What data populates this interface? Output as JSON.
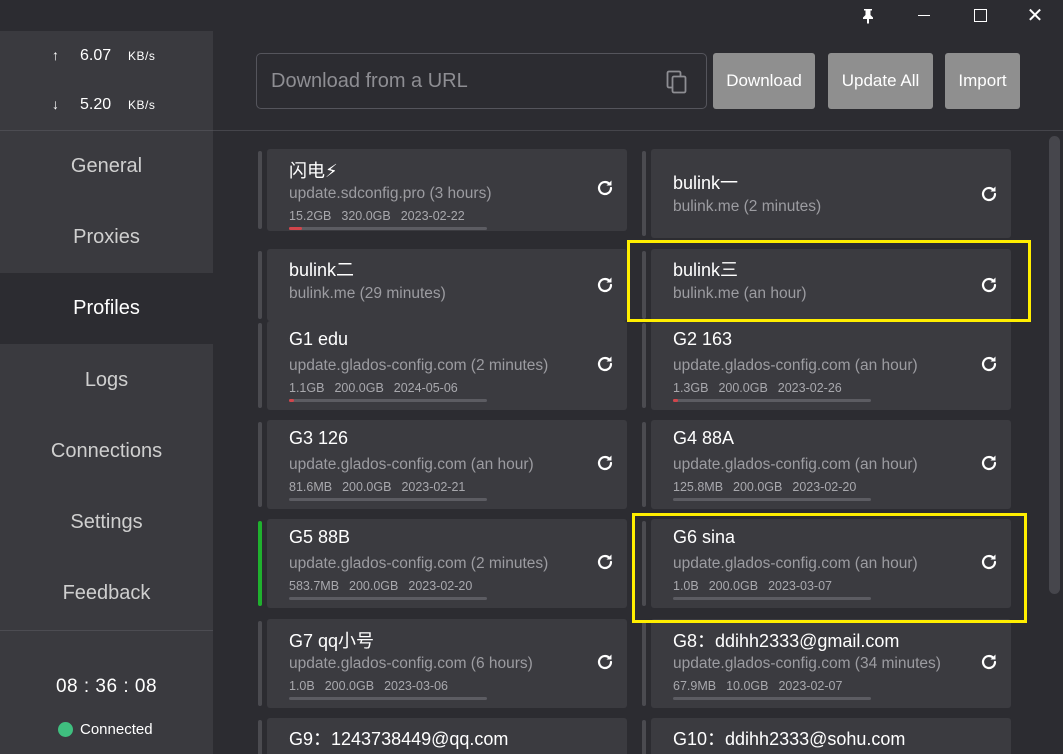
{
  "window": {
    "pin_icon": "pin-icon",
    "controls": [
      "minimize-icon",
      "maximize-icon",
      "close-icon"
    ]
  },
  "traffic": {
    "up_arrow": "↑",
    "up_value": "6.07",
    "up_unit": "KB/s",
    "down_arrow": "↓",
    "down_value": "5.20",
    "down_unit": "KB/s"
  },
  "nav": {
    "general": "General",
    "proxies": "Proxies",
    "profiles": "Profiles",
    "logs": "Logs",
    "connections": "Connections",
    "settings": "Settings",
    "feedback": "Feedback"
  },
  "status": {
    "clock": "08 : 36 : 08",
    "connection": "Connected",
    "connection_color": "#3fbf7f"
  },
  "toolbar": {
    "url_placeholder": "Download from a URL",
    "download": "Download",
    "update_all": "Update All",
    "import": "Import"
  },
  "profiles": [
    {
      "name": "闪电⚡",
      "url": "update.sdconfig.pro (3 hours)",
      "used": "15.2GB",
      "total": "320.0GB",
      "expire": "2023-02-22",
      "progress": 0.05
    },
    {
      "name": "bulink一",
      "url": "bulink.me (2 minutes)"
    },
    {
      "name": "bulink二",
      "url": "bulink.me (29 minutes)"
    },
    {
      "name": "bulink三",
      "url": "bulink.me (an hour)"
    },
    {
      "name": "G1 edu",
      "url": "update.glados-config.com (2 minutes)",
      "used": "1.1GB",
      "total": "200.0GB",
      "expire": "2024-05-06",
      "progress": 0.01
    },
    {
      "name": "G2 163",
      "url": "update.glados-config.com (an hour)",
      "used": "1.3GB",
      "total": "200.0GB",
      "expire": "2023-02-26",
      "progress": 0.01
    },
    {
      "name": "G3 126",
      "url": "update.glados-config.com (an hour)",
      "used": "81.6MB",
      "total": "200.0GB",
      "expire": "2023-02-21",
      "progress": 0.0
    },
    {
      "name": "G4 88A",
      "url": "update.glados-config.com (an hour)",
      "used": "125.8MB",
      "total": "200.0GB",
      "expire": "2023-02-20",
      "progress": 0.0
    },
    {
      "name": "G5 88B",
      "url": "update.glados-config.com (2 minutes)",
      "used": "583.7MB",
      "total": "200.0GB",
      "expire": "2023-02-20",
      "progress": 0.0
    },
    {
      "name": "G6 sina",
      "url": "update.glados-config.com (an hour)",
      "used": "1.0B",
      "total": "200.0GB",
      "expire": "2023-03-07",
      "progress": 0.0
    },
    {
      "name": "G7 qq小号",
      "url": "update.glados-config.com (6 hours)",
      "used": "1.0B",
      "total": "200.0GB",
      "expire": "2023-03-06",
      "progress": 0.0
    },
    {
      "name": "G8：ddihh2333@gmail.com",
      "url": "update.glados-config.com (34 minutes)",
      "used": "67.9MB",
      "total": "10.0GB",
      "expire": "2023-02-07",
      "progress": 0.0
    },
    {
      "name": "G9：1243738449@qq.com"
    },
    {
      "name": "G10：ddihh2333@sohu.com"
    }
  ],
  "accent": {
    "selected_strip": "#1fb12e",
    "highlight_box": "#ffee00",
    "usage_fill": "#d2454b"
  }
}
